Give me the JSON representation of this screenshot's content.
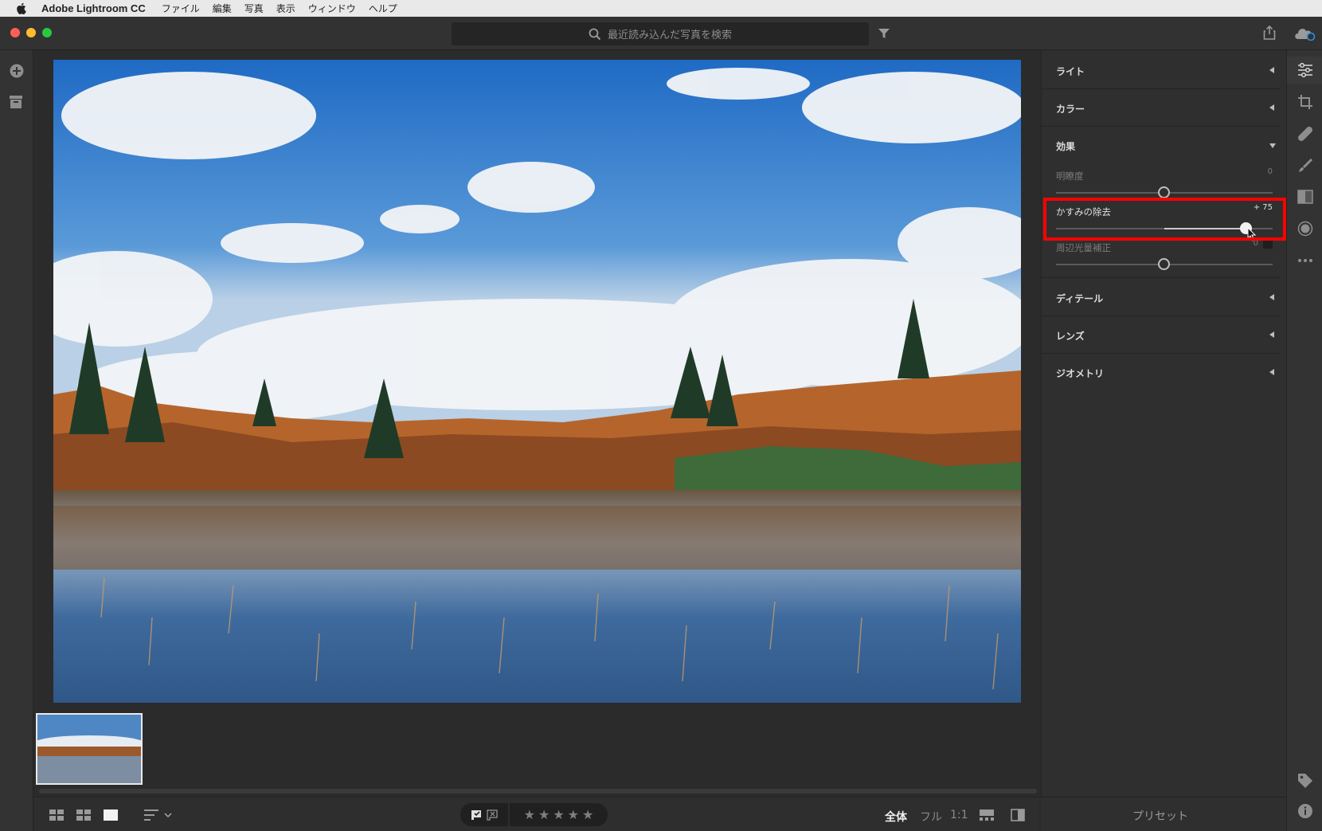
{
  "menubar": {
    "app_name": "Adobe Lightroom CC",
    "items": [
      "ファイル",
      "編集",
      "写真",
      "表示",
      "ウィンドウ",
      "ヘルプ"
    ]
  },
  "search": {
    "placeholder": "最近読み込んだ写真を検索"
  },
  "panel": {
    "sections": [
      {
        "label": "ライト",
        "state": "collapsed"
      },
      {
        "label": "カラー",
        "state": "collapsed"
      },
      {
        "label": "効果",
        "state": "expanded"
      },
      {
        "label": "ディテール",
        "state": "collapsed"
      },
      {
        "label": "レンズ",
        "state": "collapsed"
      },
      {
        "label": "ジオメトリ",
        "state": "collapsed"
      }
    ],
    "sliders": [
      {
        "label": "明瞭度",
        "value": "0",
        "level": 0
      },
      {
        "label": "かすみの除去",
        "value": "+ 75",
        "level": 75
      },
      {
        "label": "周辺光量補正",
        "value": "0",
        "level": 0
      }
    ]
  },
  "bottombar": {
    "stars": [
      "★",
      "★",
      "★",
      "★",
      "★"
    ],
    "zoom_fit": "全体",
    "zoom_fill": "フル",
    "zoom_1to1": "1:1"
  },
  "presets": {
    "label": "プリセット"
  },
  "colors": {
    "highlight": "#ff0000",
    "sky": "#3b7ac8"
  },
  "icons": [
    "apple-icon",
    "search-icon",
    "filter-icon",
    "share-icon",
    "cloud-sync-icon",
    "add-photos-icon",
    "library-icon",
    "edit-sliders-icon",
    "crop-icon",
    "healing-icon",
    "brush-icon",
    "linear-gradient-icon",
    "radial-gradient-icon",
    "more-icon",
    "tag-icon",
    "info-icon"
  ]
}
